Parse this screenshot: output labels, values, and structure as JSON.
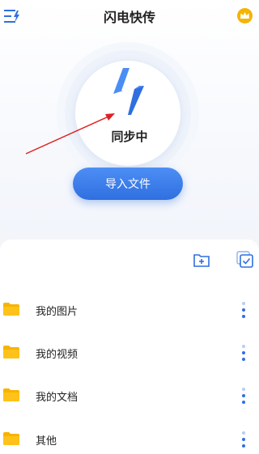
{
  "header": {
    "title": "闪电快传",
    "menu_icon": "menu-icon",
    "vip_icon": "crown-icon"
  },
  "sync": {
    "status": "同步中",
    "icon": "lightning-bolt-icon",
    "import_label": "导入文件"
  },
  "toolbar": {
    "new_folder_icon": "new-folder-icon",
    "select_icon": "multi-select-icon"
  },
  "folders": [
    {
      "name": "我的图片"
    },
    {
      "name": "我的视频"
    },
    {
      "name": "我的文档"
    },
    {
      "name": "其他"
    }
  ],
  "colors": {
    "accent": "#2f6fe0",
    "folder": "#f6b400",
    "vip": "#f5b400",
    "annotation_arrow": "#e02020"
  }
}
